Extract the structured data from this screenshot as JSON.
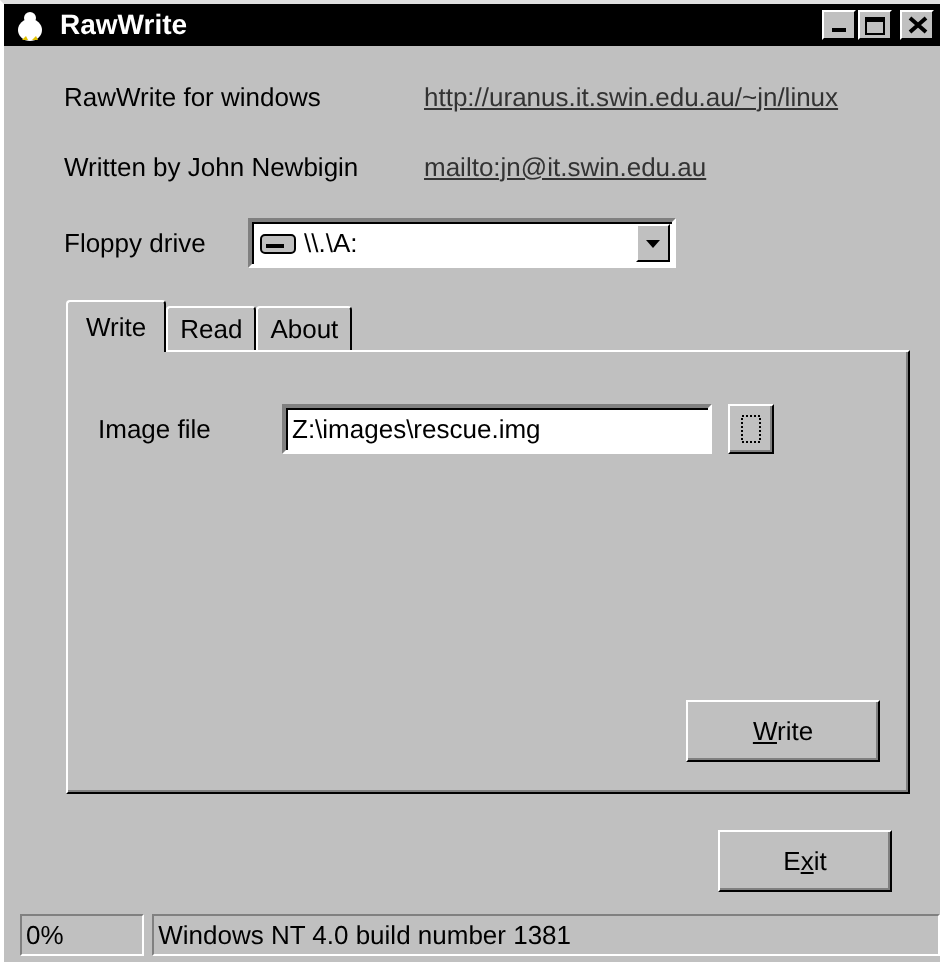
{
  "window": {
    "title": "RawWrite"
  },
  "info": [
    {
      "label": "RawWrite for windows",
      "link": "http://uranus.it.swin.edu.au/~jn/linux"
    },
    {
      "label": "Written by John Newbigin",
      "link": "mailto:jn@it.swin.edu.au"
    }
  ],
  "floppy_drive": {
    "label": "Floppy drive",
    "value": "\\\\.\\A:"
  },
  "tabs": [
    {
      "label": "Write",
      "selected": true
    },
    {
      "label": "Read",
      "selected": false
    },
    {
      "label": "About",
      "selected": false
    }
  ],
  "image_file": {
    "label": "Image file",
    "value": "Z:\\images\\rescue.img"
  },
  "write_button": {
    "access_key": "W",
    "label_after": "rite"
  },
  "exit_button": {
    "label_before": "E",
    "access_key": "x",
    "label_after": "it"
  },
  "status_bar": {
    "progress": "0%",
    "message": "Windows NT 4.0 build number 1381"
  }
}
